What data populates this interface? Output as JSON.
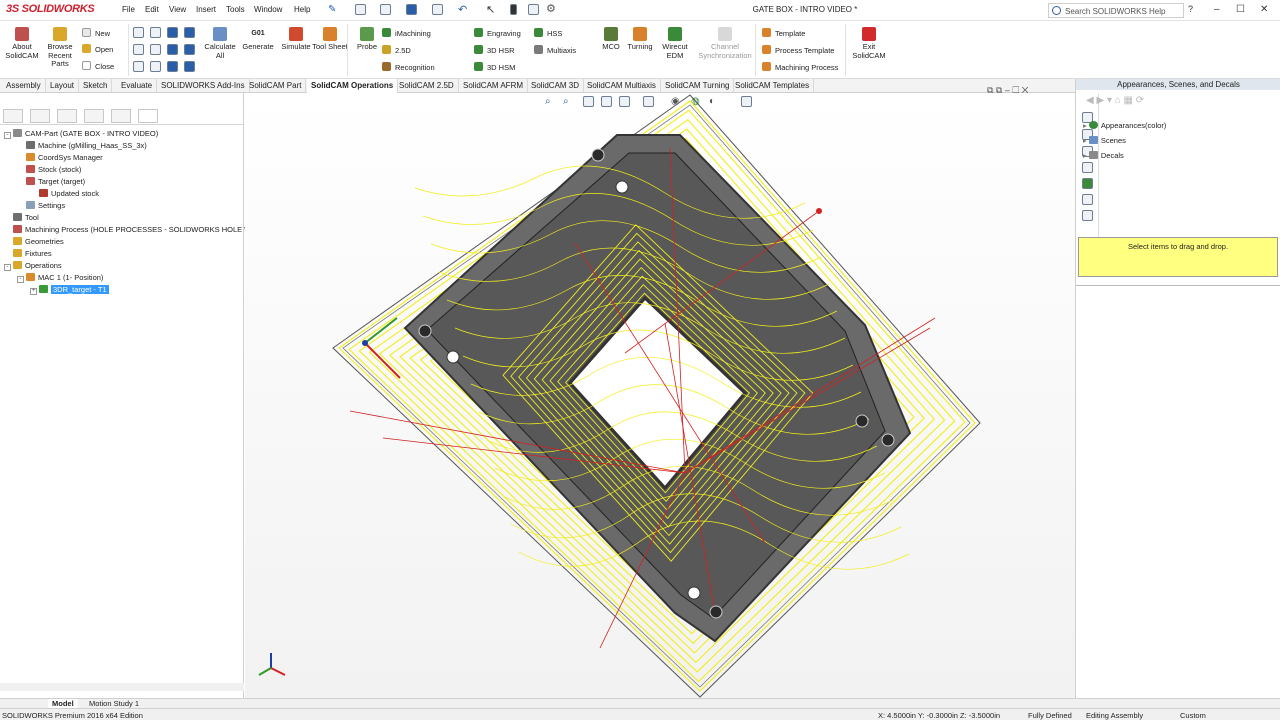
{
  "app": {
    "logo_prefix": "3S",
    "logo_text": "SOLIDWORKS",
    "doc_title": "GATE BOX - INTRO VIDEO *",
    "help_search": "Search SOLIDWORKS Help"
  },
  "menu": [
    "File",
    "Edit",
    "View",
    "Insert",
    "Tools",
    "Window",
    "Help"
  ],
  "ribbon": {
    "about": "About SolidCAM",
    "browse": "Browse Recent Parts",
    "new": "New",
    "open": "Open",
    "close": "Close",
    "calculate": "Calculate All",
    "generate": "Generate",
    "simulate": "Simulate",
    "tool_sheet": "Tool Sheet",
    "probe": "Probe",
    "imachining": "iMachining",
    "twod": "2.5D",
    "recognition": "Recognition",
    "engraving": "Engraving",
    "hsr": "3D HSR",
    "hsm": "3D HSM",
    "hss": "HSS",
    "multiaxis": "Multiaxis",
    "mco": "MCO",
    "turning": "Turning",
    "wirecut": "Wirecut EDM",
    "channel_sync": "Channel Synchronization",
    "template": "Template",
    "process_template": "Process Template",
    "machining_process": "Machining Process",
    "exit": "Exit SolidCAM",
    "generate_glyph": "G01"
  },
  "tabs": [
    "Assembly",
    "Layout",
    "Sketch",
    "Evaluate",
    "SOLIDWORKS Add-Ins",
    "SolidCAM Part",
    "SolidCAM Operations",
    "SolidCAM 2.5D",
    "SolidCAM AFRM",
    "SolidCAM 3D",
    "SolidCAM Multiaxis",
    "SolidCAM Turning",
    "SolidCAM Templates"
  ],
  "tree": [
    {
      "label": "CAM-Part (GATE BOX - INTRO VIDEO)",
      "depth": 0,
      "color": "#8a8a8a",
      "exp": "-"
    },
    {
      "label": "Machine (gMilling_Haas_SS_3x)",
      "depth": 1,
      "color": "#6d6d6d",
      "exp": ""
    },
    {
      "label": "CoordSys Manager",
      "depth": 1,
      "color": "#d98a2b",
      "exp": ""
    },
    {
      "label": "Stock (stock)",
      "depth": 1,
      "color": "#c0504d",
      "exp": ""
    },
    {
      "label": "Target (target)",
      "depth": 1,
      "color": "#c0504d",
      "exp": ""
    },
    {
      "label": "Updated stock",
      "depth": 2,
      "color": "#b03a2e",
      "exp": ""
    },
    {
      "label": "Settings",
      "depth": 1,
      "color": "#8aa0b8",
      "exp": ""
    },
    {
      "label": "Tool",
      "depth": 0,
      "color": "#6f6f6f",
      "exp": ""
    },
    {
      "label": "Machining Process (HOLE PROCESSES - SOLIDWORKS HOLE WIZA",
      "depth": 0,
      "color": "#c0504d",
      "exp": ""
    },
    {
      "label": "Geometries",
      "depth": 0,
      "color": "#d9a82b",
      "exp": ""
    },
    {
      "label": "Fixtures",
      "depth": 0,
      "color": "#d9a82b",
      "exp": ""
    },
    {
      "label": "Operations",
      "depth": 0,
      "color": "#d9a82b",
      "exp": "-"
    },
    {
      "label": "MAC 1 (1- Position)",
      "depth": 1,
      "color": "#d98a2b",
      "exp": "-"
    },
    {
      "label": "3DR_target - T1",
      "depth": 2,
      "color": "#3a9a3a",
      "exp": "+",
      "selected": true
    }
  ],
  "right_panel": {
    "title": "Appearances, Scenes, and Decals",
    "items": [
      "Appearances(color)",
      "Scenes",
      "Decals"
    ],
    "tip": "Select items to drag and drop."
  },
  "bottom_tabs": [
    "Model",
    "Motion Study 1"
  ],
  "status": {
    "edition": "SOLIDWORKS Premium 2016 x64 Edition",
    "coords": "X: 4.5000in Y: -0.3000in Z: -3.5000in",
    "defined": "Fully Defined",
    "editing": "Editing Assembly",
    "units": "Custom"
  },
  "colors": {
    "toolpath": "#f2ee1a",
    "rapid": "#d42020",
    "part": "#5b5b5b",
    "selection": "#3399ff",
    "tip_bg": "#ffff80"
  }
}
